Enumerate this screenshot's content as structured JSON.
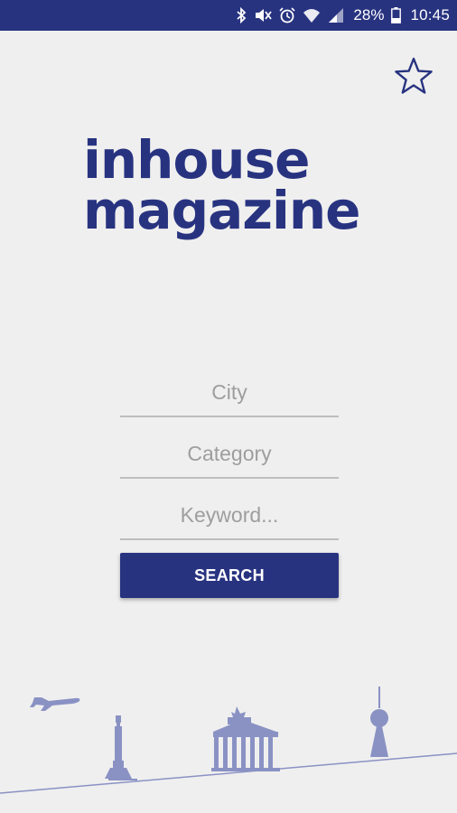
{
  "status_bar": {
    "battery": "28%",
    "time": "10:45",
    "icons": [
      "bluetooth-icon",
      "mute-icon",
      "alarm-icon",
      "wifi-icon",
      "signal-icon",
      "battery-icon"
    ]
  },
  "header": {
    "favorite_icon": "star-outline-icon"
  },
  "logo": {
    "line1": "inhouse",
    "line2": "magazine"
  },
  "form": {
    "city_placeholder": "City",
    "category_placeholder": "Category",
    "keyword_placeholder": "Keyword...",
    "search_label": "SEARCH"
  },
  "colors": {
    "primary": "#283380",
    "background": "#efefef",
    "illustration": "#8a92c4"
  }
}
